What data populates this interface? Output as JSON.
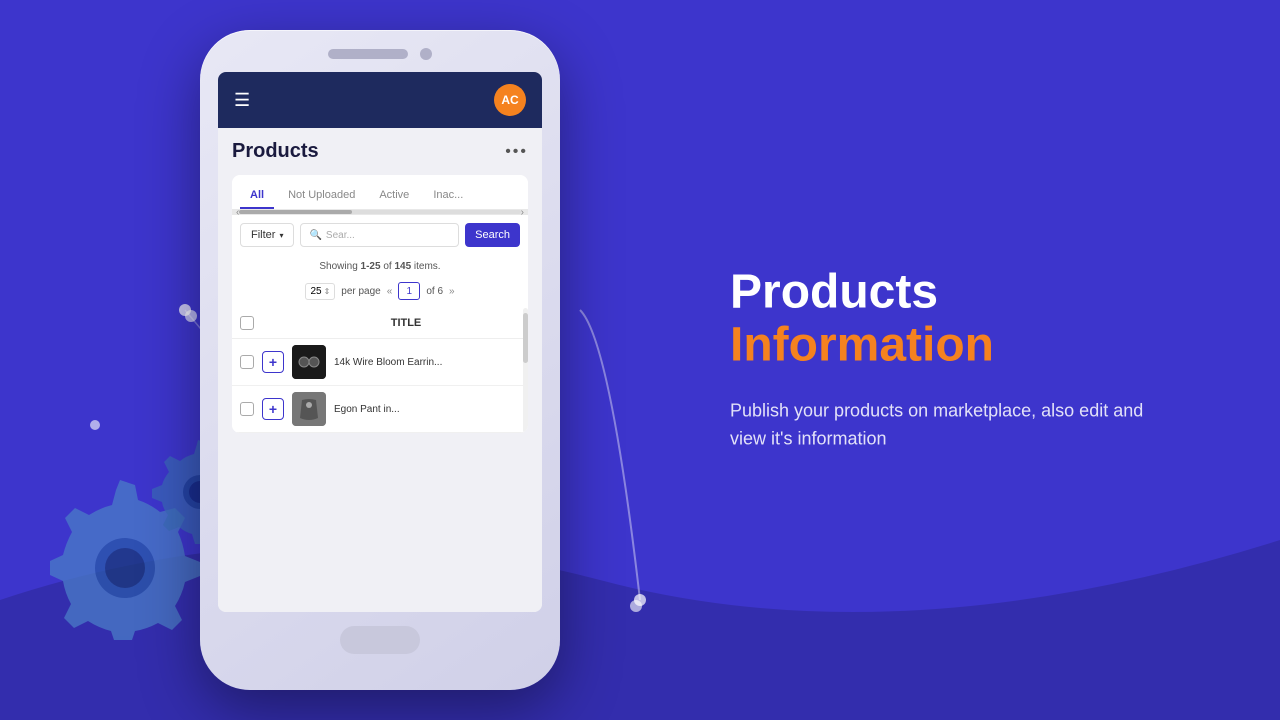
{
  "background": {
    "color": "#3d35cc"
  },
  "header": {
    "avatar_initials": "AC",
    "avatar_color": "#f5821f"
  },
  "page": {
    "title": "Products",
    "more_icon": "•••"
  },
  "tabs": [
    {
      "label": "All",
      "active": true
    },
    {
      "label": "Not Uploaded",
      "active": false
    },
    {
      "label": "Active",
      "active": false
    },
    {
      "label": "Inac...",
      "active": false
    }
  ],
  "filter": {
    "filter_label": "Filter",
    "search_placeholder": "Sear...",
    "search_button_label": "Search"
  },
  "showing": {
    "text": "Showing 1-25 of 145 items.",
    "range": "1-25",
    "total": "145"
  },
  "pagination": {
    "per_page": "25",
    "page_num": "1",
    "total_pages": "6"
  },
  "table": {
    "column_title": "TITLE",
    "rows": [
      {
        "name": "14k Wire Bloom Earrin...",
        "has_image": true,
        "image_style": "dark"
      },
      {
        "name": "Egon Pant in...",
        "has_image": true,
        "image_style": "gray"
      }
    ]
  },
  "right_panel": {
    "title_line1": "Products",
    "title_line2": "Information",
    "description": "Publish your products on marketplace, also edit and view it's information"
  }
}
